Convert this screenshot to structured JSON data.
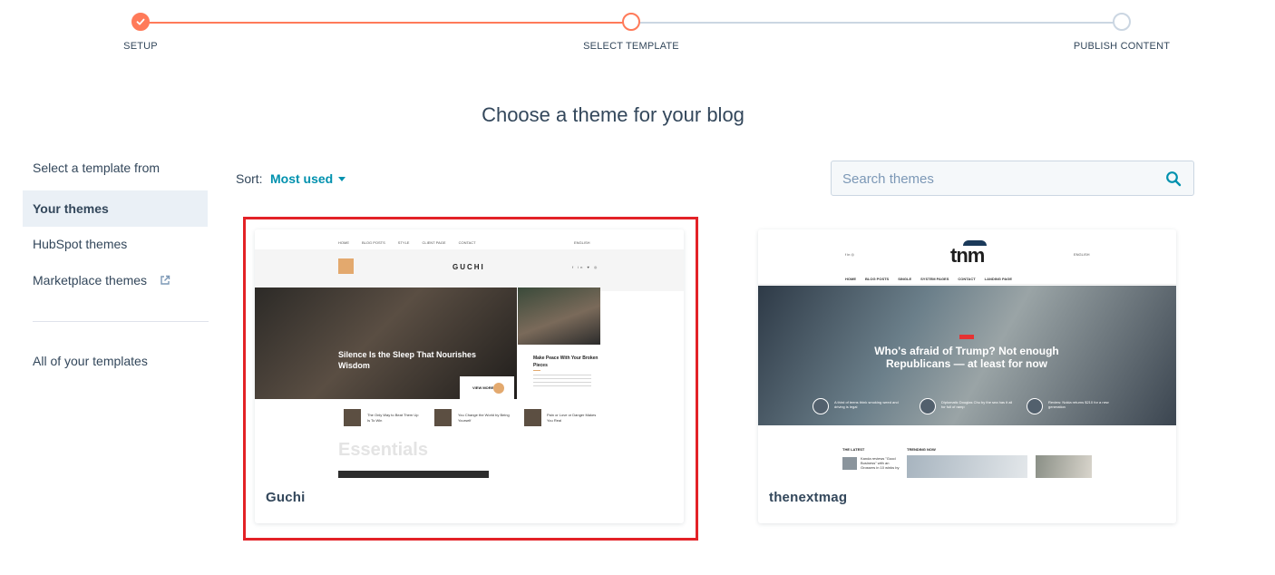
{
  "stepper": {
    "steps": [
      {
        "label": "SETUP",
        "state": "complete"
      },
      {
        "label": "SELECT TEMPLATE",
        "state": "current"
      },
      {
        "label": "PUBLISH CONTENT",
        "state": "upcoming"
      }
    ]
  },
  "page": {
    "title": "Choose a theme for your blog"
  },
  "sidebar": {
    "heading": "Select a template from",
    "items": [
      {
        "label": "Your themes",
        "active": true
      },
      {
        "label": "HubSpot themes",
        "active": false
      },
      {
        "label": "Marketplace themes",
        "active": false,
        "icon": "external-link-icon"
      }
    ],
    "footer_item": "All of your templates"
  },
  "sort": {
    "label": "Sort:",
    "value": "Most used"
  },
  "search": {
    "placeholder": "Search themes",
    "value": ""
  },
  "themes": [
    {
      "name": "Guchi",
      "selected": true,
      "preview": {
        "nav": [
          "HOME",
          "BLOG POSTS",
          "STYLE",
          "CLIENT PAGE",
          "CONTACT"
        ],
        "lang": "ENGLISH",
        "logo": "GUCHI",
        "hero_title": "Silence Is the Sleep That Nourishes Wisdom",
        "read_more": "VIEW MORE",
        "side_title": "Make Peace With Your Broken Pieces",
        "posts": [
          "The Only Way to Beat Them Up Is To Win",
          "You Change the World by Being Yourself",
          "Pain or Love or Danger Makes You Real"
        ],
        "section": "Essentials"
      }
    },
    {
      "name": "thenextmag",
      "selected": false,
      "preview": {
        "logo": "tnm",
        "lang": "ENGLISH",
        "nav": [
          "HOME",
          "BLOG POSTS",
          "SINGLE",
          "SYSTEM PAGES",
          "CONTACT",
          "LANDING PAGE"
        ],
        "hero_title": "Who's afraid of Trump? Not enough Republicans — at least for now",
        "mini_posts": [
          "A third of teens think smoking weed and driving is legal",
          "Diplomatic Douglas Chu by the sea has it all for full of ramp",
          "Review: Nokia returns $210 for a new generation"
        ],
        "latest": "THE LATEST",
        "trending": "TRENDING NOW",
        "latest_post": "Kanda reviews \"Good Business\" with an Grossers in 10 winks by"
      }
    }
  ],
  "colors": {
    "accent": "#ff7a59",
    "link": "#0091ae",
    "text": "#33475b",
    "selection": "#e32227",
    "inactive_step": "#cbd6e2"
  }
}
